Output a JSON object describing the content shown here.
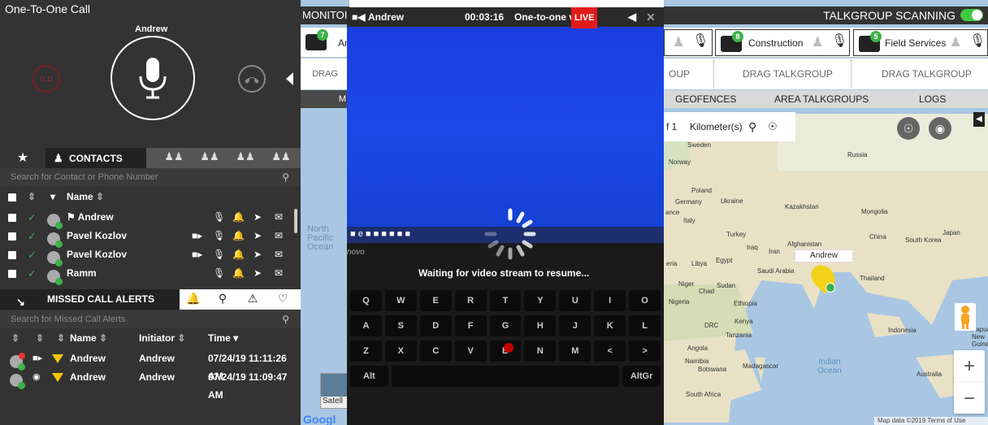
{
  "call": {
    "title": "One-To-One Call",
    "callee": "Andrew",
    "record_label": "o.o"
  },
  "contacts_tabs": {
    "star": "★",
    "contacts_label": "CONTACTS"
  },
  "contacts": {
    "search_placeholder": "Search for Contact or Phone Number",
    "name_header": "Name",
    "rows": [
      {
        "name": "Andrew",
        "flag": "⚑",
        "video": false
      },
      {
        "name": "Pavel Kozlov",
        "video": true
      },
      {
        "name": "Pavel Kozlov",
        "video": true
      },
      {
        "name": "Ramm",
        "video": false
      }
    ]
  },
  "missed": {
    "tab_label": "MISSED CALL ALERTS",
    "search_placeholder": "Search for Missed Call Alerts",
    "headers": {
      "name": "Name",
      "initiator": "Initiator",
      "time": "Time"
    },
    "rows": [
      {
        "name": "Andrew",
        "initiator": "Andrew",
        "time": "07/24/19 11:11:26 AM",
        "type": "video"
      },
      {
        "name": "Andrew",
        "initiator": "Andrew",
        "time": "07/24/19 11:09:47 AM",
        "type": "audio"
      }
    ]
  },
  "monitor": {
    "title": "MONITOI",
    "tg_label": "An",
    "tg_count": "7",
    "drag_label": "DRAG",
    "tab_label": "M",
    "ocean_label_1": "North",
    "ocean_label_2": "Pacific",
    "ocean_label_3": "Ocean",
    "satellite_label": "Satell",
    "google_label": "Googl"
  },
  "video": {
    "caller": "Andrew",
    "timer": "00:03:16",
    "title": "One-to-one vid...",
    "live": "LIVE",
    "status": "Waiting for video stream to resume...",
    "laptop_brand": "novo"
  },
  "talkgroups": {
    "scanning_label": "TALKGROUP SCANNING",
    "scanning_on": true,
    "items": [
      {
        "label": "Construction",
        "count": "8"
      },
      {
        "label": "Field Services",
        "count": "5"
      }
    ],
    "drag_labels": [
      "OUP",
      "DRAG TALKGROUP",
      "DRAG TALKGROUP"
    ],
    "tabs": [
      "GEOFENCES",
      "AREA TALKGROUPS",
      "LOGS"
    ]
  },
  "map": {
    "scale_prefix": "f 1",
    "scale_unit": "Kilometer(s)",
    "marker_label": "Andrew",
    "countries": [
      {
        "name": "Sweden"
      },
      {
        "name": "Norway"
      },
      {
        "name": "Russia"
      },
      {
        "name": "Poland"
      },
      {
        "name": "Germany"
      },
      {
        "name": "Ukraine"
      },
      {
        "name": "Kazakhstan"
      },
      {
        "name": "Mongolia"
      },
      {
        "name": "Italy"
      },
      {
        "name": "Turkey"
      },
      {
        "name": "Afghanistan"
      },
      {
        "name": "China"
      },
      {
        "name": "Iraq"
      },
      {
        "name": "Iran"
      },
      {
        "name": "South Korea"
      },
      {
        "name": "Japan"
      },
      {
        "name": "Libya"
      },
      {
        "name": "Egypt"
      },
      {
        "name": "Saudi Arabia"
      },
      {
        "name": "Niger"
      },
      {
        "name": "Chad"
      },
      {
        "name": "Sudan"
      },
      {
        "name": "Thailand"
      },
      {
        "name": "Nigeria"
      },
      {
        "name": "Ethiopia"
      },
      {
        "name": "Kenya"
      },
      {
        "name": "DRC"
      },
      {
        "name": "Tanzania"
      },
      {
        "name": "Indonesia"
      },
      {
        "name": "Angola"
      },
      {
        "name": "Namibia"
      },
      {
        "name": "Botswana"
      },
      {
        "name": "Madagascar"
      },
      {
        "name": "Australia"
      },
      {
        "name": "South Africa"
      },
      {
        "name": "Papua New Guinea"
      },
      {
        "name": "ance"
      },
      {
        "name": "eria"
      }
    ],
    "ocean_label": "Indian Ocean",
    "zoom_in": "+",
    "zoom_out": "−",
    "attribution": "Map data ©2019   Terms of Use"
  },
  "colors": {
    "panel_dark": "#333333",
    "accent_green": "#3fb14a",
    "live_red": "#e21b1b",
    "map_water": "#a9c7e3",
    "alert_yellow": "#f1c40f"
  }
}
